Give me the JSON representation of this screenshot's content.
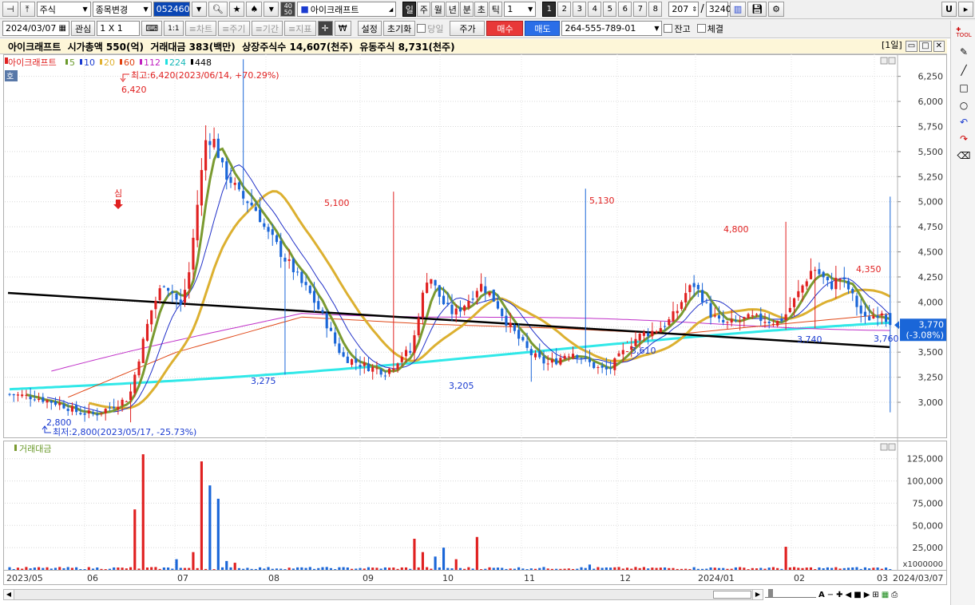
{
  "toolbar1": {
    "market_type": "주식",
    "change_code_label": "종목변경",
    "stock_code": "052460",
    "share_count": "40\n50",
    "stock_name": "아이크래프트",
    "periods": [
      "일",
      "주",
      "월",
      "년",
      "분",
      "초",
      "틱"
    ],
    "interval_value": "1",
    "number_tabs": [
      "1",
      "2",
      "3",
      "4",
      "5",
      "6",
      "7",
      "8"
    ],
    "page_current": "207",
    "page_separator": "/",
    "page_total": "3240"
  },
  "toolbar2": {
    "date": "2024/03/07",
    "interest_label": "관심",
    "ratio_value": "1 X 1",
    "ratio_button": "1:1",
    "chart_btn": "≡차트",
    "cycle_btn": "≡주기",
    "period_btn": "≡기간",
    "indicator_btn": "≡지표",
    "won_btn": "₩",
    "settings_btn": "설정",
    "reset_btn": "초기화",
    "same_day_label": "당일",
    "price_btn": "주가",
    "buy_btn": "매수",
    "sell_btn": "매도",
    "account_number": "264-555-789-01",
    "balance_label": "잔고",
    "fills_label": "체결"
  },
  "infobar": {
    "text": "아이크래프트  시가총액 550(억)  거래대금 383(백만)  상장주식수 14,607(천주)  유동주식 8,731(천주)",
    "period_label": "[1일]"
  },
  "price_pane": {
    "legend": [
      {
        "label": "아이크래프트",
        "color": "#e02020"
      },
      {
        "label": "5",
        "color": "#6b9a2c"
      },
      {
        "label": "10",
        "color": "#1a3bd0"
      },
      {
        "label": "20",
        "color": "#e0b030"
      },
      {
        "label": "60",
        "color": "#e04010"
      },
      {
        "label": "112",
        "color": "#c020c0"
      },
      {
        "label": "224",
        "color": "#20e0e0"
      },
      {
        "label": "448",
        "color": "#000000"
      }
    ],
    "pane_badge": "호",
    "high_annotation": "최고:6,420(2023/06/14, +70.29%)",
    "low_annotation": "최저:2,800(2023/05/17, -25.73%)",
    "signal_label": "심",
    "current_price": "3,770",
    "current_change": "(-3.08%)",
    "price_ticks": [
      "6,250",
      "6,000",
      "5,750",
      "5,500",
      "5,250",
      "5,000",
      "4,750",
      "4,500",
      "4,250",
      "4,000",
      "3,750",
      "3,500",
      "3,250",
      "3,000"
    ],
    "peak_labels": [
      {
        "text": "6,420",
        "color": "red"
      },
      {
        "text": "5,100",
        "color": "red"
      },
      {
        "text": "5,130",
        "color": "red"
      },
      {
        "text": "4,800",
        "color": "red"
      },
      {
        "text": "4,350",
        "color": "red"
      },
      {
        "text": "2,800",
        "color": "blue"
      },
      {
        "text": "3,275",
        "color": "blue"
      },
      {
        "text": "3,205",
        "color": "blue"
      },
      {
        "text": "3,610",
        "color": "blue"
      },
      {
        "text": "3,740",
        "color": "blue"
      },
      {
        "text": "3,760",
        "color": "blue"
      }
    ]
  },
  "volume_pane": {
    "title": "거래대금",
    "ticks": [
      "125,000",
      "100,000",
      "75,000",
      "50,000",
      "25,000"
    ],
    "unit": "x1000000"
  },
  "x_axis": {
    "labels": [
      "2023/05",
      "06",
      "07",
      "08",
      "09",
      "10",
      "11",
      "12",
      "2024/01",
      "02",
      "03",
      "2024/03/07"
    ]
  },
  "colors": {
    "up": "#e02020",
    "down": "#1a66d8",
    "ma5": "#7a9a30",
    "ma10": "#2030c8",
    "ma20": "#dcb030",
    "ma60": "#e04818",
    "ma112": "#c030c8",
    "ma224": "#30e8e8",
    "trendline": "#000000"
  }
}
